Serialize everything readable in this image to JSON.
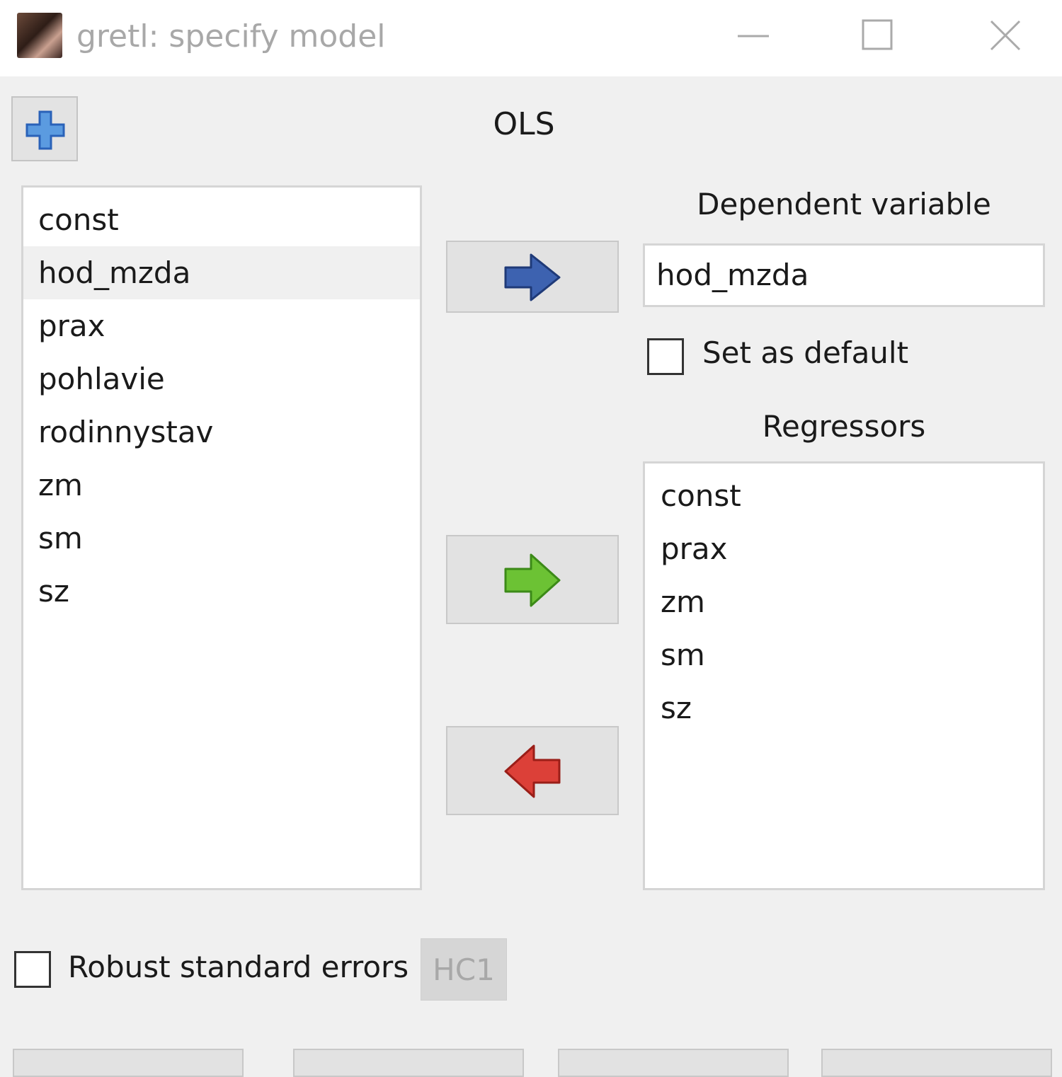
{
  "window": {
    "title": "gretl: specify model"
  },
  "estimator": {
    "label": "OLS"
  },
  "available_variables": {
    "items": [
      "const",
      "hod_mzda",
      "prax",
      "pohlavie",
      "rodinnystav",
      "zm",
      "sm",
      "sz"
    ],
    "selected": "hod_mzda"
  },
  "dependent": {
    "label": "Dependent variable",
    "value": "hod_mzda",
    "set_default_label": "Set as default",
    "set_default_checked": false
  },
  "regressors": {
    "label": "Regressors",
    "items": [
      "const",
      "prax",
      "zm",
      "sm",
      "sz"
    ]
  },
  "options": {
    "robust_label": "Robust standard errors",
    "robust_checked": false,
    "hc_label": "HC1"
  },
  "colors": {
    "arrow_dependent": "#3d62b0",
    "arrow_add": "#5cb82c",
    "arrow_remove": "#d63a34",
    "add_icon": "#3a7bd5"
  }
}
